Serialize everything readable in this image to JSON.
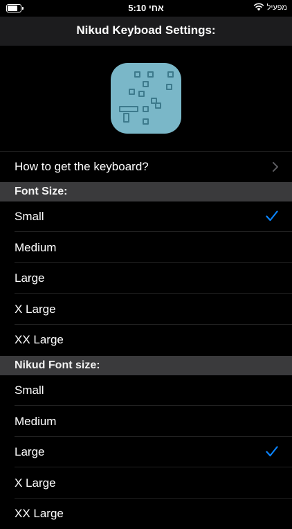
{
  "status_bar": {
    "time": "5:10 אחי",
    "carrier": "מפעיל",
    "battery_level": 0.8
  },
  "nav": {
    "title": "Nikud Keyboad Settings:"
  },
  "info_row": {
    "label": "How to get the keyboard?"
  },
  "font_size": {
    "header": "Font Size:",
    "options": [
      "Small",
      "Medium",
      "Large",
      "X Large",
      "XX Large"
    ],
    "selected": "Small"
  },
  "nikud_font_size": {
    "header": "Nikud Font size:",
    "options": [
      "Small",
      "Medium",
      "Large",
      "X Large",
      "XX Large"
    ],
    "selected": "Large"
  },
  "colors": {
    "background": "#000000",
    "navbar": "#1c1c1e",
    "section_header": "#3a3a3c",
    "checkmark": "#0a84ff",
    "logo": "#7ab7c8"
  },
  "icons": {
    "battery": "battery-icon",
    "wifi": "wifi-icon",
    "chevron": "chevron-right-icon",
    "check": "checkmark-icon",
    "logo": "app-logo"
  }
}
